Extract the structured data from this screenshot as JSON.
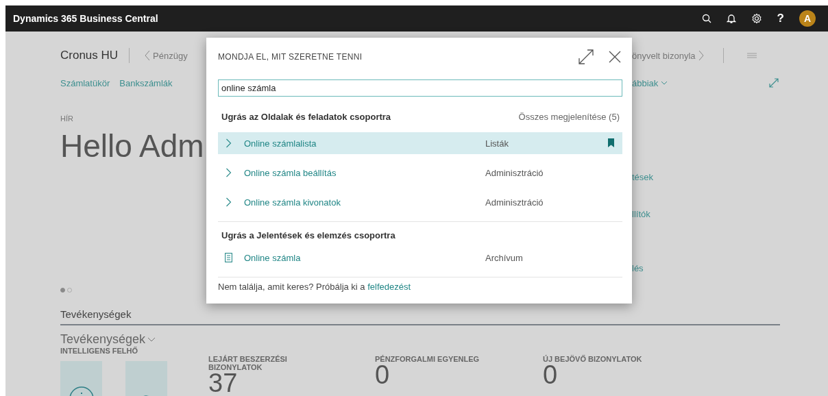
{
  "app_bar": {
    "title": "Dynamics 365 Business Central",
    "help": "?",
    "avatar": "A"
  },
  "header": {
    "company": "Cronus HU",
    "back_link": "Pénzügy",
    "forward_link": "önyvelt bizonyla"
  },
  "nav": {
    "links": [
      "Számlatükör",
      "Bankszámlák"
    ],
    "more": "ábbiak"
  },
  "headline": {
    "label": "HÍR",
    "greeting": "Hello Adm"
  },
  "side_links": [
    "tések",
    "llítók",
    "lés"
  ],
  "carousel": [
    {
      "selected": true
    },
    {
      "selected": false
    }
  ],
  "activities": {
    "title": "Tevékenységek",
    "group": "Tevékenységek",
    "cloud_label": "INTELLIGENS FELHŐ",
    "cues": [
      {
        "label": "LEJÁRT BESZERZÉSI BIZONYLATOK",
        "value": "37"
      },
      {
        "label": "PÉNZFORGALMI EGYENLEG",
        "value": "0"
      },
      {
        "label": "ÚJ BEJÖVŐ BIZONYLATOK",
        "value": "0"
      }
    ]
  },
  "dialog": {
    "title": "MONDJA EL, MIT SZERETNE TENNI",
    "search": {
      "value": "online számla"
    },
    "groups": [
      {
        "heading": "Ugrás az Oldalak és feladatok csoportra",
        "show_all": "Összes megjelenítése (5)",
        "results": [
          {
            "kind": "page",
            "name": "Online számlalista",
            "category": "Listák",
            "selected": true,
            "bookmarked": true
          },
          {
            "kind": "page",
            "name": "Online számla beállítás",
            "category": "Adminisztráció",
            "selected": false,
            "bookmarked": false
          },
          {
            "kind": "page",
            "name": "Online számla kivonatok",
            "category": "Adminisztráció",
            "selected": false,
            "bookmarked": false
          }
        ]
      },
      {
        "heading": "Ugrás a Jelentések és elemzés csoportra",
        "results": [
          {
            "kind": "report",
            "name": "Online számla",
            "category": "Archívum",
            "selected": false,
            "bookmarked": false
          }
        ]
      }
    ],
    "footer": {
      "text": "Nem találja, amit keres? Próbálja ki a",
      "link": "felfedezést"
    }
  }
}
